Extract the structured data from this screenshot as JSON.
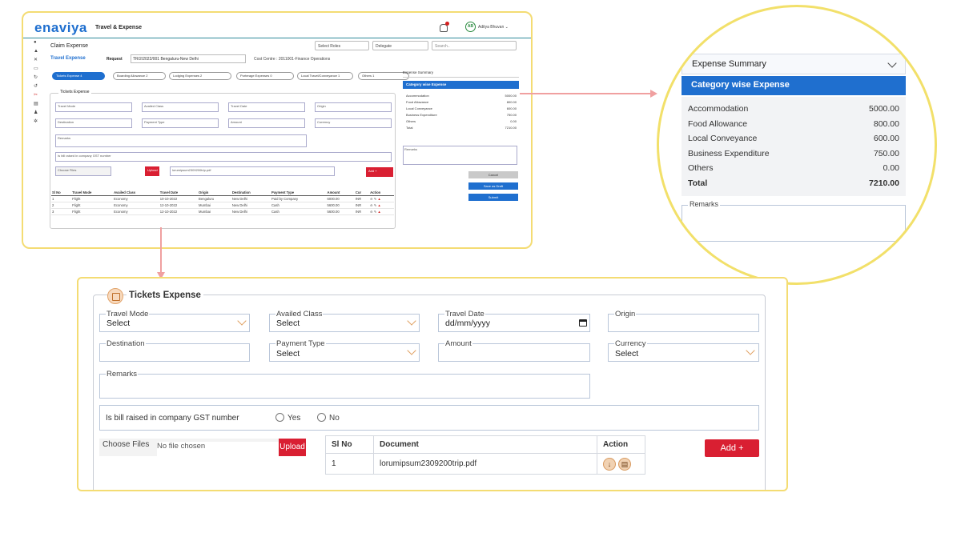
{
  "app": {
    "logo": "enaviya",
    "title": "Travel & Expense",
    "user_initials": "AB",
    "user_name": "Aditya Bhuvan ⌄",
    "page_title": "Claim Expense",
    "select_roles": "Select Roles",
    "delegate": "Delegate",
    "search_placeholder": "Search.."
  },
  "request": {
    "tab": "Travel Expense",
    "label": "Request",
    "value": "TR/2/2022/001 Bengaluru-New Delhi",
    "cost_centre": "Cost Centre : 2011001-Finance Operations"
  },
  "tabs": [
    {
      "label": "Tickets Expense 4"
    },
    {
      "label": "Boarding Allowance 2"
    },
    {
      "label": "Lodging Expenses 2"
    },
    {
      "label": "Porterage Expenses 0"
    },
    {
      "label": "Local Travel/Conveyance 1"
    },
    {
      "label": "Others 1"
    }
  ],
  "mini_table": {
    "headers": [
      "Sl No",
      "Travel Mode",
      "Availed Class",
      "Travel Date",
      "Origin",
      "Destination",
      "Payment Type",
      "Amount",
      "Cur",
      "Action"
    ],
    "rows": [
      [
        "1",
        "Flight",
        "Economy",
        "10-10-2022",
        "Bengaluru",
        "New Delhi",
        "Paid by Company",
        "6000.00",
        "INR"
      ],
      [
        "2",
        "Flight",
        "Economy",
        "12-10-2022",
        "Mumbai",
        "New Delhi",
        "Cash",
        "5600.00",
        "INR"
      ],
      [
        "3",
        "Flight",
        "Economy",
        "12-10-2022",
        "Mumbai",
        "New Delhi",
        "Cash",
        "5600.00",
        "INR"
      ]
    ]
  },
  "mini_buttons": {
    "cancel": "Cancel",
    "draft": "Save as Draft",
    "submit": "Submit"
  },
  "summary": {
    "header": "Expense Summary",
    "bar": "Category wise Expense",
    "rows": [
      {
        "label": "Accommodation",
        "value": "5000.00"
      },
      {
        "label": "Food Allowance",
        "value": "800.00"
      },
      {
        "label": "Local Conveyance",
        "value": "600.00"
      },
      {
        "label": "Business Expenditure",
        "value": "750.00"
      },
      {
        "label": "Others",
        "value": "0.00"
      },
      {
        "label": "Total",
        "value": "7210.00"
      }
    ],
    "remarks_label": "Remarks"
  },
  "tickets": {
    "title": "Tickets Expense",
    "travel_mode": {
      "label": "Travel Mode",
      "value": "Select"
    },
    "availed_class": {
      "label": "Availed Class",
      "value": "Select"
    },
    "travel_date": {
      "label": "Travel Date",
      "value": "dd/mm/yyyy"
    },
    "origin": {
      "label": "Origin",
      "value": ""
    },
    "destination": {
      "label": "Destination",
      "value": ""
    },
    "payment_type": {
      "label": "Payment Type",
      "value": "Select"
    },
    "amount": {
      "label": "Amount",
      "value": ""
    },
    "currency": {
      "label": "Currency",
      "value": "Select"
    },
    "remarks": {
      "label": "Remarks",
      "value": ""
    },
    "gst_question": "Is bill raised in company GST number",
    "gst_yes": "Yes",
    "gst_no": "No",
    "choose_files": "Choose Files",
    "no_file": "No file chosen",
    "upload": "Upload",
    "add": "Add +"
  },
  "documents": {
    "headers": [
      "Sl No",
      "Document",
      "Action"
    ],
    "rows": [
      {
        "sl": "1",
        "name": "lorumipsum2309200trip.pdf"
      }
    ]
  },
  "colors": {
    "accent": "#1f6fcf",
    "danger": "#d91f32",
    "highlight_border": "#f4dc73",
    "arrow": "#f0a0a0"
  }
}
